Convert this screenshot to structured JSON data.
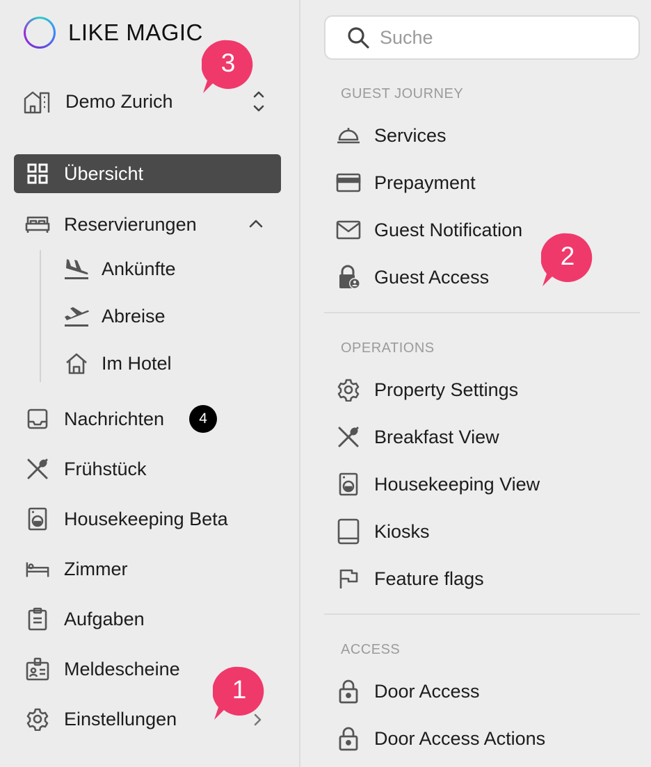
{
  "logo": {
    "text": "LIKE MAGIC"
  },
  "property": {
    "name": "Demo Zurich"
  },
  "nav": {
    "overview": "Übersicht",
    "reservations": "Reservierungen",
    "arrivals": "Ankünfte",
    "departures": "Abreise",
    "in_hotel": "Im Hotel",
    "messages": "Nachrichten",
    "messages_count": "4",
    "breakfast": "Frühstück",
    "housekeeping": "Housekeeping Beta",
    "rooms": "Zimmer",
    "tasks": "Aufgaben",
    "registration": "Meldescheine",
    "settings": "Einstellungen"
  },
  "annotations": {
    "one": "1",
    "two": "2",
    "three": "3"
  },
  "search": {
    "placeholder": "Suche"
  },
  "settings_menu": {
    "guest_journey": {
      "heading": "GUEST JOURNEY",
      "services": "Services",
      "prepayment": "Prepayment",
      "guest_notification": "Guest Notification",
      "guest_access": "Guest Access"
    },
    "operations": {
      "heading": "OPERATIONS",
      "property_settings": "Property Settings",
      "breakfast_view": "Breakfast View",
      "housekeeping_view": "Housekeeping View",
      "kiosks": "Kiosks",
      "feature_flags": "Feature flags"
    },
    "access": {
      "heading": "ACCESS",
      "door_access": "Door Access",
      "door_access_actions": "Door Access Actions"
    }
  },
  "colors": {
    "accent_pink": "#f0396b",
    "active_bg": "#4a4a4a",
    "badge_bg": "#000000"
  }
}
